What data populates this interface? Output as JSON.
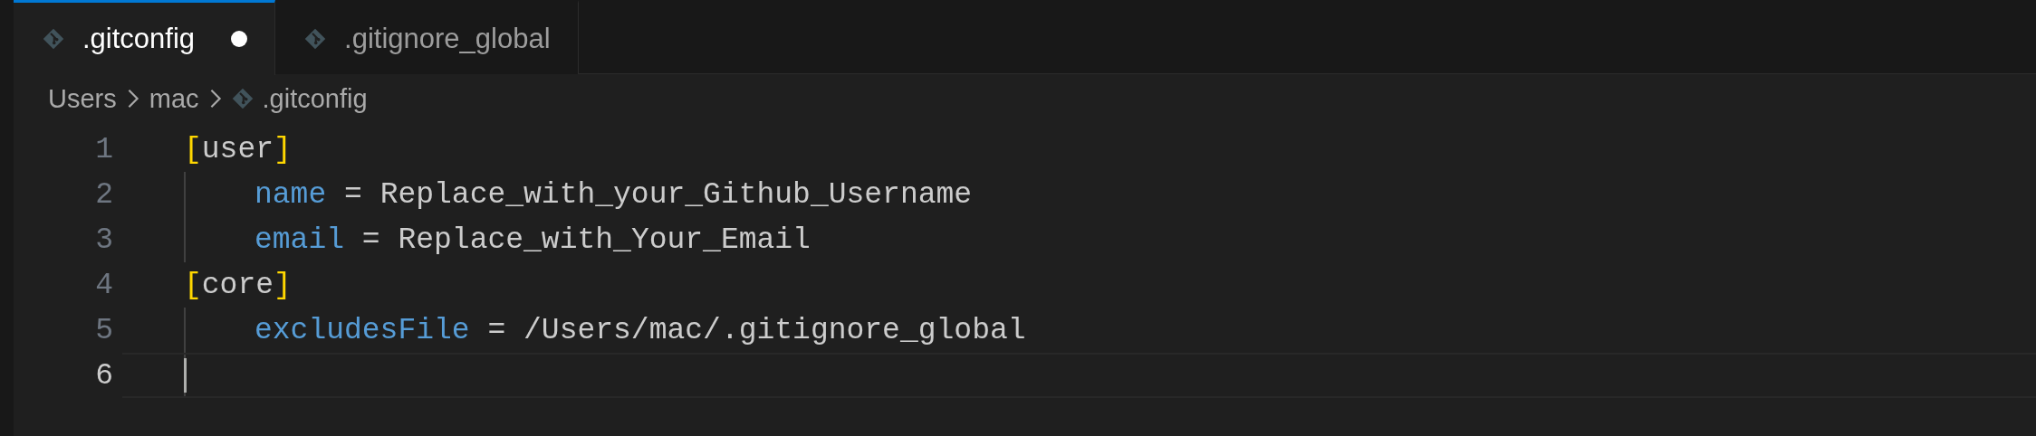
{
  "tabs": [
    {
      "label": ".gitconfig",
      "selected": true,
      "modified": true
    },
    {
      "label": ".gitignore_global",
      "selected": false,
      "modified": false
    }
  ],
  "breadcrumb": [
    {
      "label": "Users",
      "kind": "folder"
    },
    {
      "label": "mac",
      "kind": "folder"
    },
    {
      "label": ".gitconfig",
      "kind": "file"
    }
  ],
  "lines": [
    {
      "number": "1",
      "current": false,
      "tokens": [
        {
          "kind": "bracket",
          "text": "["
        },
        {
          "kind": "plain",
          "text": "user"
        },
        {
          "kind": "bracket",
          "text": "]"
        }
      ],
      "children": [
        {
          "number": "2",
          "current": false,
          "tokens": [
            {
              "kind": "key",
              "text": "name"
            },
            {
              "kind": "plain",
              "text": " = Replace_with_your_Github_Username"
            }
          ]
        },
        {
          "number": "3",
          "current": false,
          "tokens": [
            {
              "kind": "key",
              "text": "email"
            },
            {
              "kind": "plain",
              "text": " = Replace_with_Your_Email"
            }
          ]
        }
      ]
    },
    {
      "number": "4",
      "current": false,
      "tokens": [
        {
          "kind": "bracket",
          "text": "["
        },
        {
          "kind": "plain",
          "text": "core"
        },
        {
          "kind": "bracket",
          "text": "]"
        }
      ],
      "children": [
        {
          "number": "5",
          "current": false,
          "tokens": [
            {
              "kind": "key",
              "text": "excludesFile"
            },
            {
              "kind": "plain",
              "text": " = /Users/mac/.gitignore_global"
            }
          ]
        },
        {
          "number": "6",
          "current": true
        }
      ]
    }
  ]
}
